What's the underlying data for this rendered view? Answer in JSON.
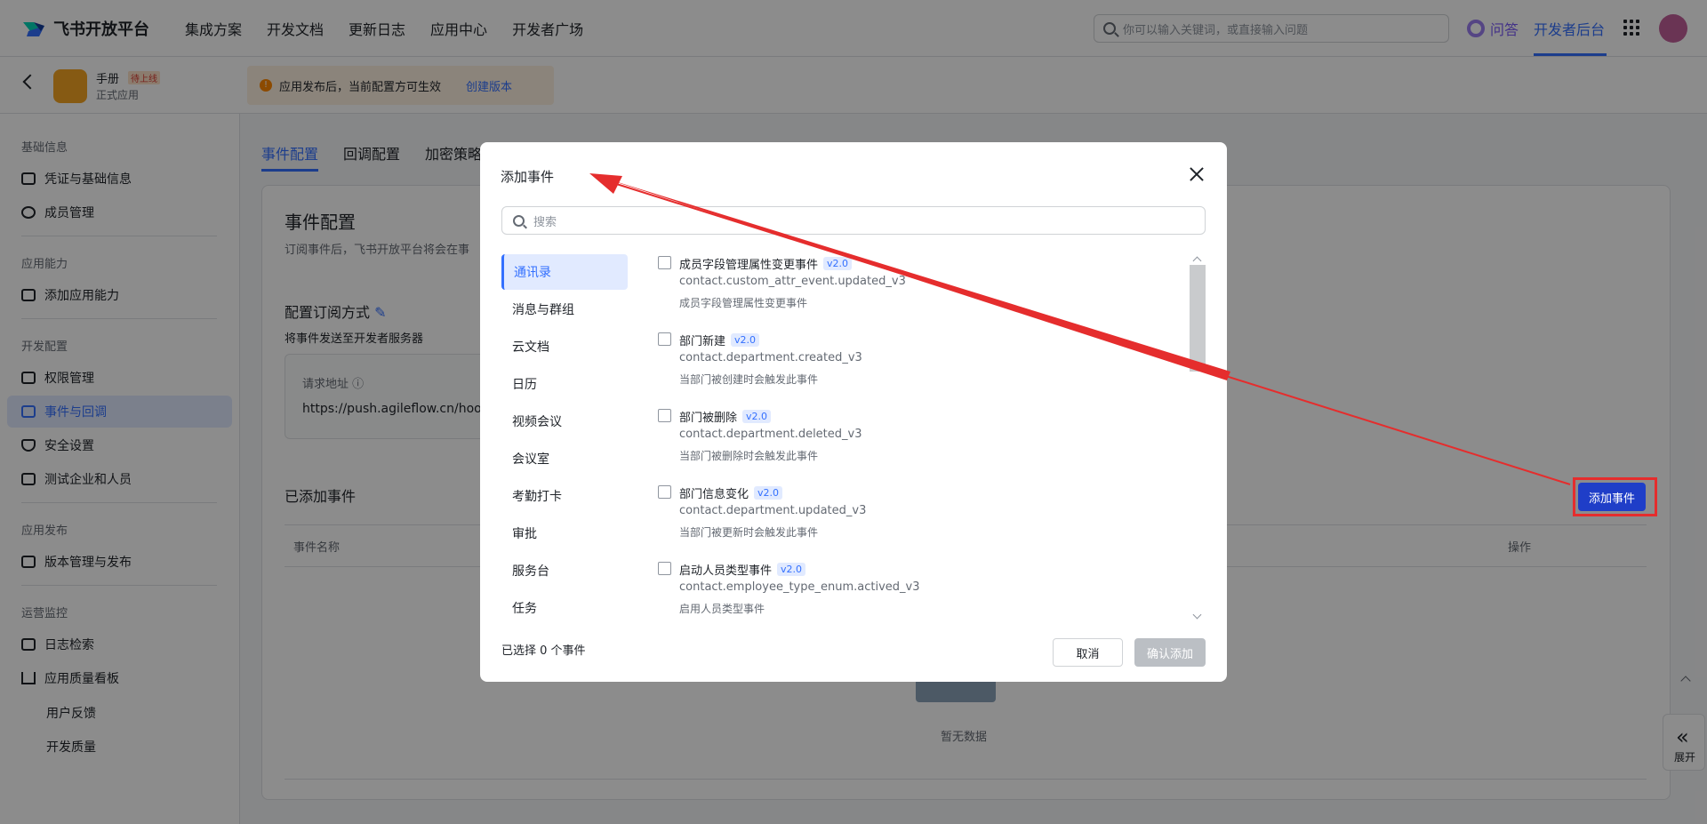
{
  "brand": {
    "name": "飞书开放平台"
  },
  "topnav": {
    "links": [
      "集成方案",
      "开发文档",
      "更新日志",
      "应用中心",
      "开发者广场"
    ],
    "search_placeholder": "你可以输入关键词，或直接输入问题",
    "qa_label": "问答",
    "dev_backend_label": "开发者后台"
  },
  "app": {
    "name": "手册",
    "status_tag": "待上线",
    "sub_label": "正式应用",
    "notice_text": "应用发布后，当前配置方可生效",
    "notice_link": "创建版本"
  },
  "sidebar": {
    "sections": {
      "basic": "基础信息",
      "ability": "应用能力",
      "dev_config": "开发配置",
      "release": "应用发布",
      "ops": "运营监控"
    },
    "items": {
      "credentials": "凭证与基础信息",
      "members": "成员管理",
      "add_ability": "添加应用能力",
      "permissions": "权限管理",
      "events": "事件与回调",
      "security": "安全设置",
      "test_org": "测试企业和人员",
      "versions": "版本管理与发布",
      "logs": "日志检索",
      "quality": "应用质量看板",
      "feedback": "用户反馈",
      "dev_quality": "开发质量"
    }
  },
  "main": {
    "tabs": [
      "事件配置",
      "回调配置",
      "加密策略"
    ],
    "title": "事件配置",
    "desc": "订阅事件后，飞书开放平台将会在事",
    "cfg_title": "配置订阅方式",
    "cfg_sub": "将事件发送至开发者服务器",
    "url_label": "请求地址",
    "url_value": "https://push.agileflow.cn/hook/a",
    "added_title": "已添加事件",
    "add_button": "添加事件",
    "th_name": "事件名称",
    "th_op": "操作",
    "empty_text": "暂无数据",
    "expand_label": "展开"
  },
  "dialog": {
    "title": "添加事件",
    "search_placeholder": "搜索",
    "categories": [
      "通讯录",
      "消息与群组",
      "云文档",
      "日历",
      "视频会议",
      "会议室",
      "考勤打卡",
      "审批",
      "服务台",
      "任务"
    ],
    "events": [
      {
        "name": "成员字段管理属性变更事件",
        "version": "v2.0",
        "key": "contact.custom_attr_event.updated_v3",
        "desc": "成员字段管理属性变更事件"
      },
      {
        "name": "部门新建",
        "version": "v2.0",
        "key": "contact.department.created_v3",
        "desc": "当部门被创建时会触发此事件"
      },
      {
        "name": "部门被删除",
        "version": "v2.0",
        "key": "contact.department.deleted_v3",
        "desc": "当部门被删除时会触发此事件"
      },
      {
        "name": "部门信息变化",
        "version": "v2.0",
        "key": "contact.department.updated_v3",
        "desc": "当部门被更新时会触发此事件"
      },
      {
        "name": "启动人员类型事件",
        "version": "v2.0",
        "key": "contact.employee_type_enum.actived_v3",
        "desc": "启用人员类型事件"
      }
    ],
    "selected_count": "已选择 0 个事件",
    "cancel": "取消",
    "confirm": "确认添加"
  },
  "colors": {
    "accent": "#3370ff",
    "annotation": "#e52d2d",
    "primary_button": "#1f3ec8"
  }
}
